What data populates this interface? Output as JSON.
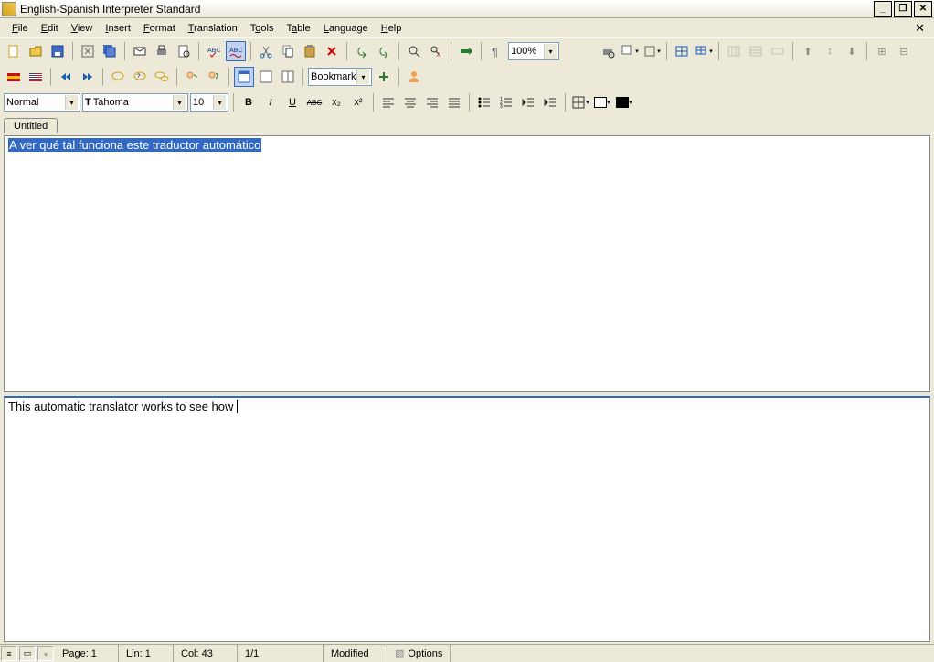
{
  "window": {
    "title": "English-Spanish Interpreter Standard"
  },
  "menu": {
    "items": [
      {
        "label": "File",
        "u": "F"
      },
      {
        "label": "Edit",
        "u": "E"
      },
      {
        "label": "View",
        "u": "V"
      },
      {
        "label": "Insert",
        "u": "I"
      },
      {
        "label": "Format",
        "u": "F"
      },
      {
        "label": "Translation",
        "u": "T"
      },
      {
        "label": "Tools",
        "u": "T"
      },
      {
        "label": "Table",
        "u": "T"
      },
      {
        "label": "Language",
        "u": "L"
      },
      {
        "label": "Help",
        "u": "H"
      }
    ]
  },
  "toolbar1": {
    "zoom": "100%"
  },
  "toolbar2": {
    "bookmark_label": "Bookmark"
  },
  "format": {
    "style": "Normal",
    "font": "Tahoma",
    "size": "10",
    "bold": "B",
    "italic": "I",
    "underline": "U",
    "strike": "ABC",
    "sub": "x₂",
    "sup": "x²"
  },
  "tabs": {
    "tab1": "Untitled"
  },
  "panes": {
    "source_text": "A ver qué tal funciona este traductor automático",
    "target_text": "This automatic translator works to see how"
  },
  "status": {
    "page": "Page:  1",
    "line": "Lin:  1",
    "col": "Col:  43",
    "pages": "1/1",
    "modified": "Modified",
    "options": "Options"
  },
  "colors": {
    "white": "#ffffff",
    "black": "#000000"
  }
}
